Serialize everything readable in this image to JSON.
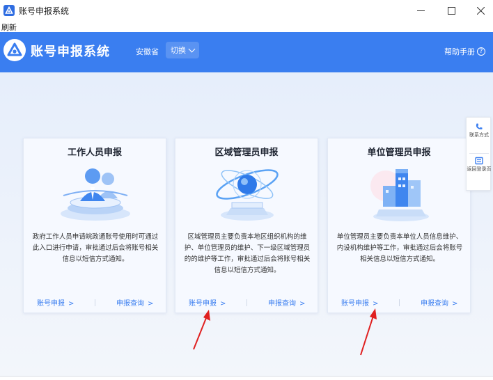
{
  "window": {
    "title": "账号申报系统",
    "menu_refresh": "刷新"
  },
  "header": {
    "title": "账号申报系统",
    "province": "安徽省",
    "switch_label": "切换",
    "help_label": "帮助手册"
  },
  "cards": [
    {
      "title": "工作人员申报",
      "description": "政府工作人员申请皖政通账号使用时可通过此入口进行申请，审批通过后会将账号相关信息以短信方式通知。",
      "apply_link": "账号申报",
      "query_link": "申报查询"
    },
    {
      "title": "区域管理员申报",
      "description": "区域管理员主要负责本地区组织机构的维护、单位管理员的维护、下一级区域管理员的的维护等工作，审批通过后会将账号相关信息以短信方式通知。",
      "apply_link": "账号申报",
      "query_link": "申报查询"
    },
    {
      "title": "单位管理员申报",
      "description": "单位管理员主要负责本单位人员信息维护、内设机构维护等工作，审批通过后会将账号相关信息以短信方式通知。",
      "apply_link": "账号申报",
      "query_link": "申报查询"
    }
  ],
  "float_panel": {
    "contact_label": "联系方式",
    "back_label": "返回登录页"
  },
  "colors": {
    "header_blue": "#3a7ef0",
    "link_blue": "#3a7ef0",
    "annotation_red": "#e02020"
  }
}
